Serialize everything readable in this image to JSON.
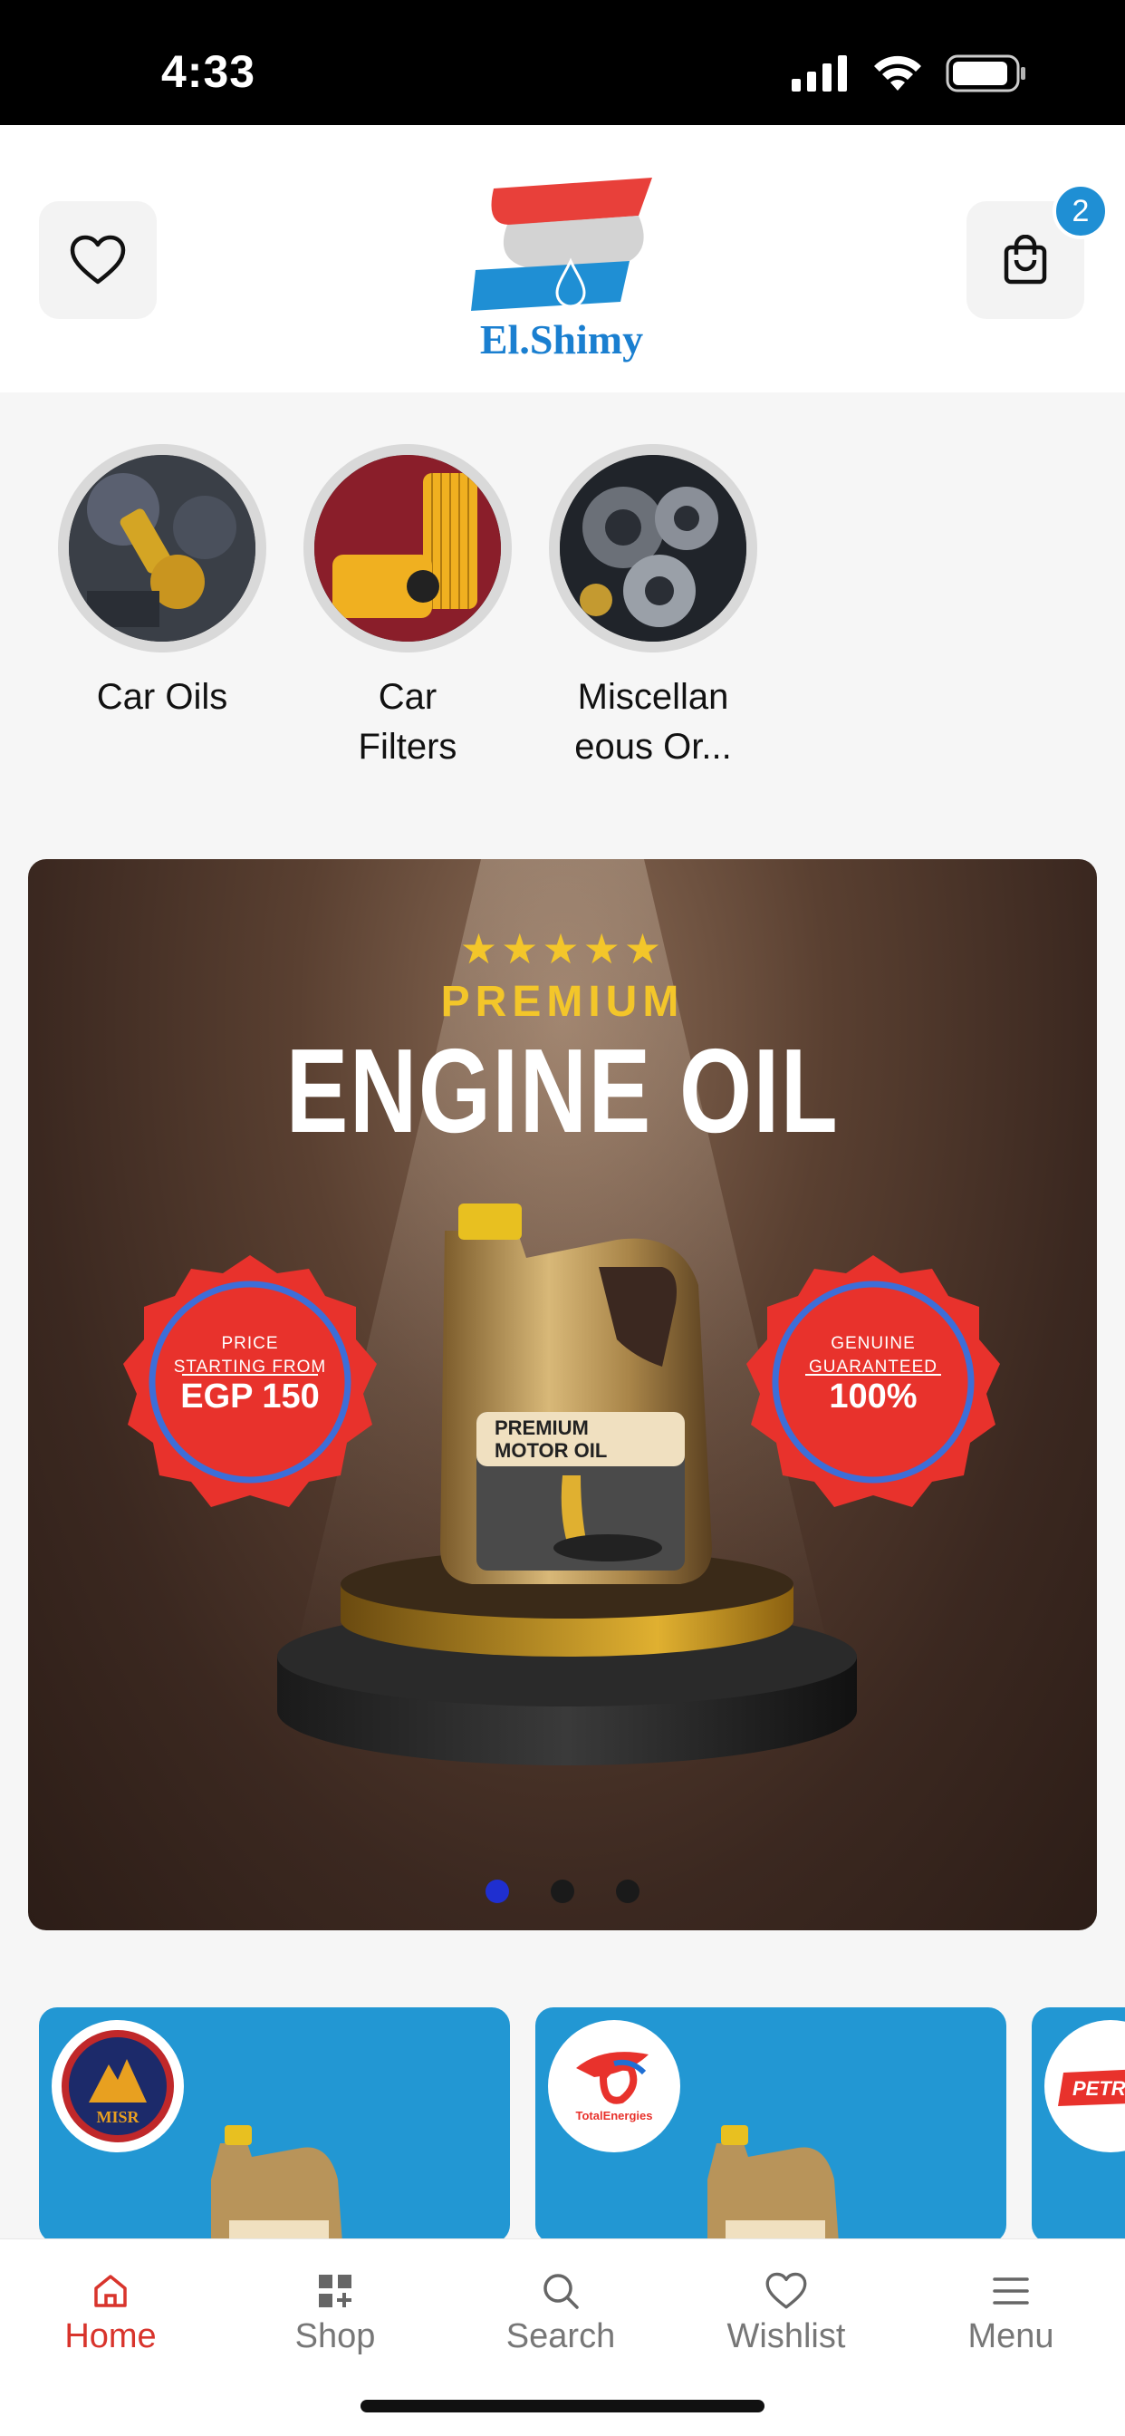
{
  "status": {
    "time": "4:33"
  },
  "header": {
    "logo_text": "El.Shimy",
    "cart_count": "2"
  },
  "categories": [
    {
      "label": "Car Oils"
    },
    {
      "label": "Car\nFilters"
    },
    {
      "label": "Miscellan\neous Or..."
    }
  ],
  "banner": {
    "stars": "★★★★★",
    "premium": "PREMIUM",
    "title": "ENGINE OIL",
    "left_seal": {
      "line1": "PRICE",
      "line2": "STARTING FROM",
      "big": "EGP 150"
    },
    "right_seal": {
      "line1": "GENUINE",
      "line2": "GUARANTEED",
      "big": "100%"
    },
    "product_label": "PREMIUM\nMOTOR OIL",
    "slides": 3,
    "active_slide": 1
  },
  "brands": [
    {
      "name": "MISR"
    },
    {
      "name": "TotalEnergies"
    },
    {
      "name": "PETRO"
    }
  ],
  "tabbar": {
    "items": [
      {
        "label": "Home",
        "icon": "home-icon",
        "active": true
      },
      {
        "label": "Shop",
        "icon": "grid-plus-icon",
        "active": false
      },
      {
        "label": "Search",
        "icon": "search-icon",
        "active": false
      },
      {
        "label": "Wishlist",
        "icon": "heart-icon",
        "active": false
      },
      {
        "label": "Menu",
        "icon": "menu-icon",
        "active": false
      }
    ]
  },
  "colors": {
    "accent_red": "#d8342c",
    "brand_blue": "#2297d3",
    "badge_blue": "#1f8fd4",
    "banner_gold": "#f3c62a"
  }
}
